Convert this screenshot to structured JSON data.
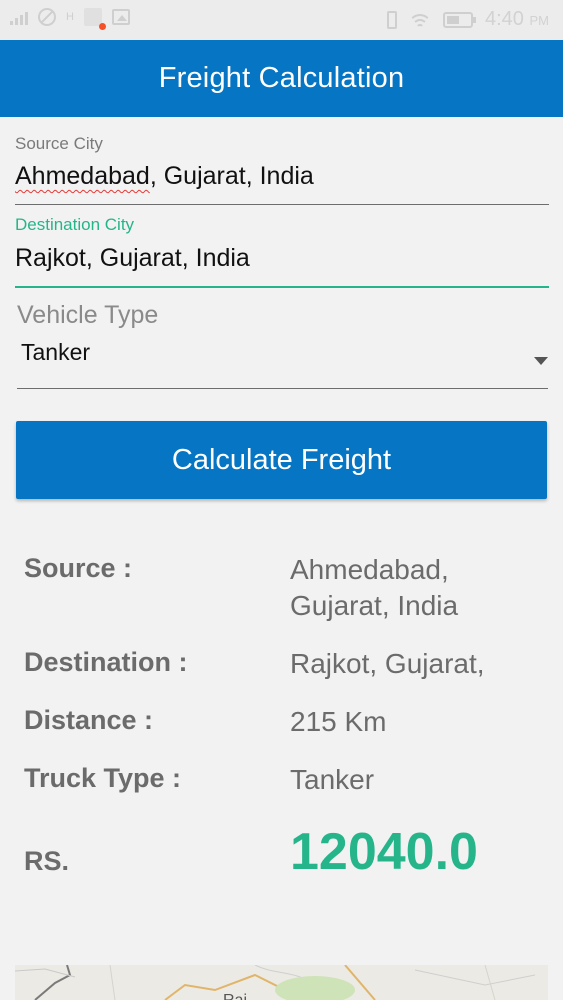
{
  "status_bar": {
    "network_label": "H",
    "time": "4:40",
    "ampm": "PM",
    "battery_level": 0.55
  },
  "header": {
    "title": "Freight Calculation"
  },
  "form": {
    "source": {
      "label": "Source City",
      "value_underlined": "Ahmedabad",
      "value_rest": ", Gujarat, India"
    },
    "destination": {
      "label": "Destination City",
      "value": "Rajkot, Gujarat, India"
    },
    "vehicle": {
      "label": "Vehicle Type",
      "selected": "Tanker"
    },
    "calculate_label": "Calculate Freight"
  },
  "results": {
    "source_label": "Source :",
    "source_value": "Ahmedabad, Gujarat, India",
    "destination_label": "Destination :",
    "destination_value": "Rajkot, Gujarat,",
    "distance_label": "Distance :",
    "distance_value": "215 Km",
    "truck_label": "Truck Type :",
    "truck_value": "Tanker",
    "price_label": "RS.",
    "price_value": "12040.0"
  },
  "map": {
    "partial_label": "Raj"
  },
  "colors": {
    "primary": "#0575c4",
    "accent": "#26b58a",
    "error_underline": "#e53935"
  },
  "icons": [
    "signal-icon",
    "blocked-icon",
    "notification-icon",
    "image-icon",
    "phone-icon",
    "wifi-icon",
    "battery-icon",
    "dropdown-arrow-icon"
  ]
}
